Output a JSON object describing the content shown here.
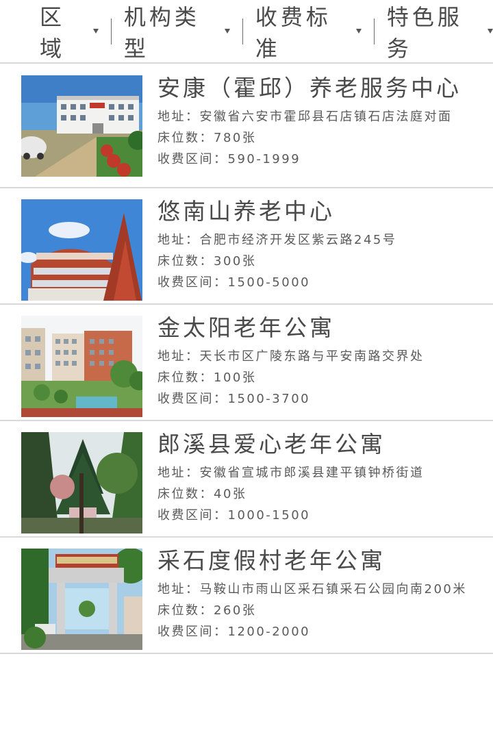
{
  "filters": [
    {
      "label": "区域"
    },
    {
      "label": "机构类型"
    },
    {
      "label": "收费标准"
    },
    {
      "label": "特色服务"
    }
  ],
  "field_labels": {
    "address": "地址：",
    "beds": "床位数：",
    "fee": "收费区间："
  },
  "institutions": [
    {
      "name": "安康（霍邱）养老服务中心",
      "address": "安徽省六安市霍邱县石店镇石店法庭对面",
      "beds": "780张",
      "fee": "590-1999"
    },
    {
      "name": "悠南山养老中心",
      "address": "合肥市经济开发区紫云路245号",
      "beds": "300张",
      "fee": "1500-5000"
    },
    {
      "name": "金太阳老年公寓",
      "address": "天长市区广陵东路与平安南路交界处",
      "beds": "100张",
      "fee": "1500-3700"
    },
    {
      "name": "郎溪县爱心老年公寓",
      "address": "安徽省宣城市郎溪县建平镇钟桥街道",
      "beds": "40张",
      "fee": "1000-1500"
    },
    {
      "name": "采石度假村老年公寓",
      "address": "马鞍山市雨山区采石镇采石公园向南200米",
      "beds": "260张",
      "fee": "1200-2000"
    }
  ]
}
